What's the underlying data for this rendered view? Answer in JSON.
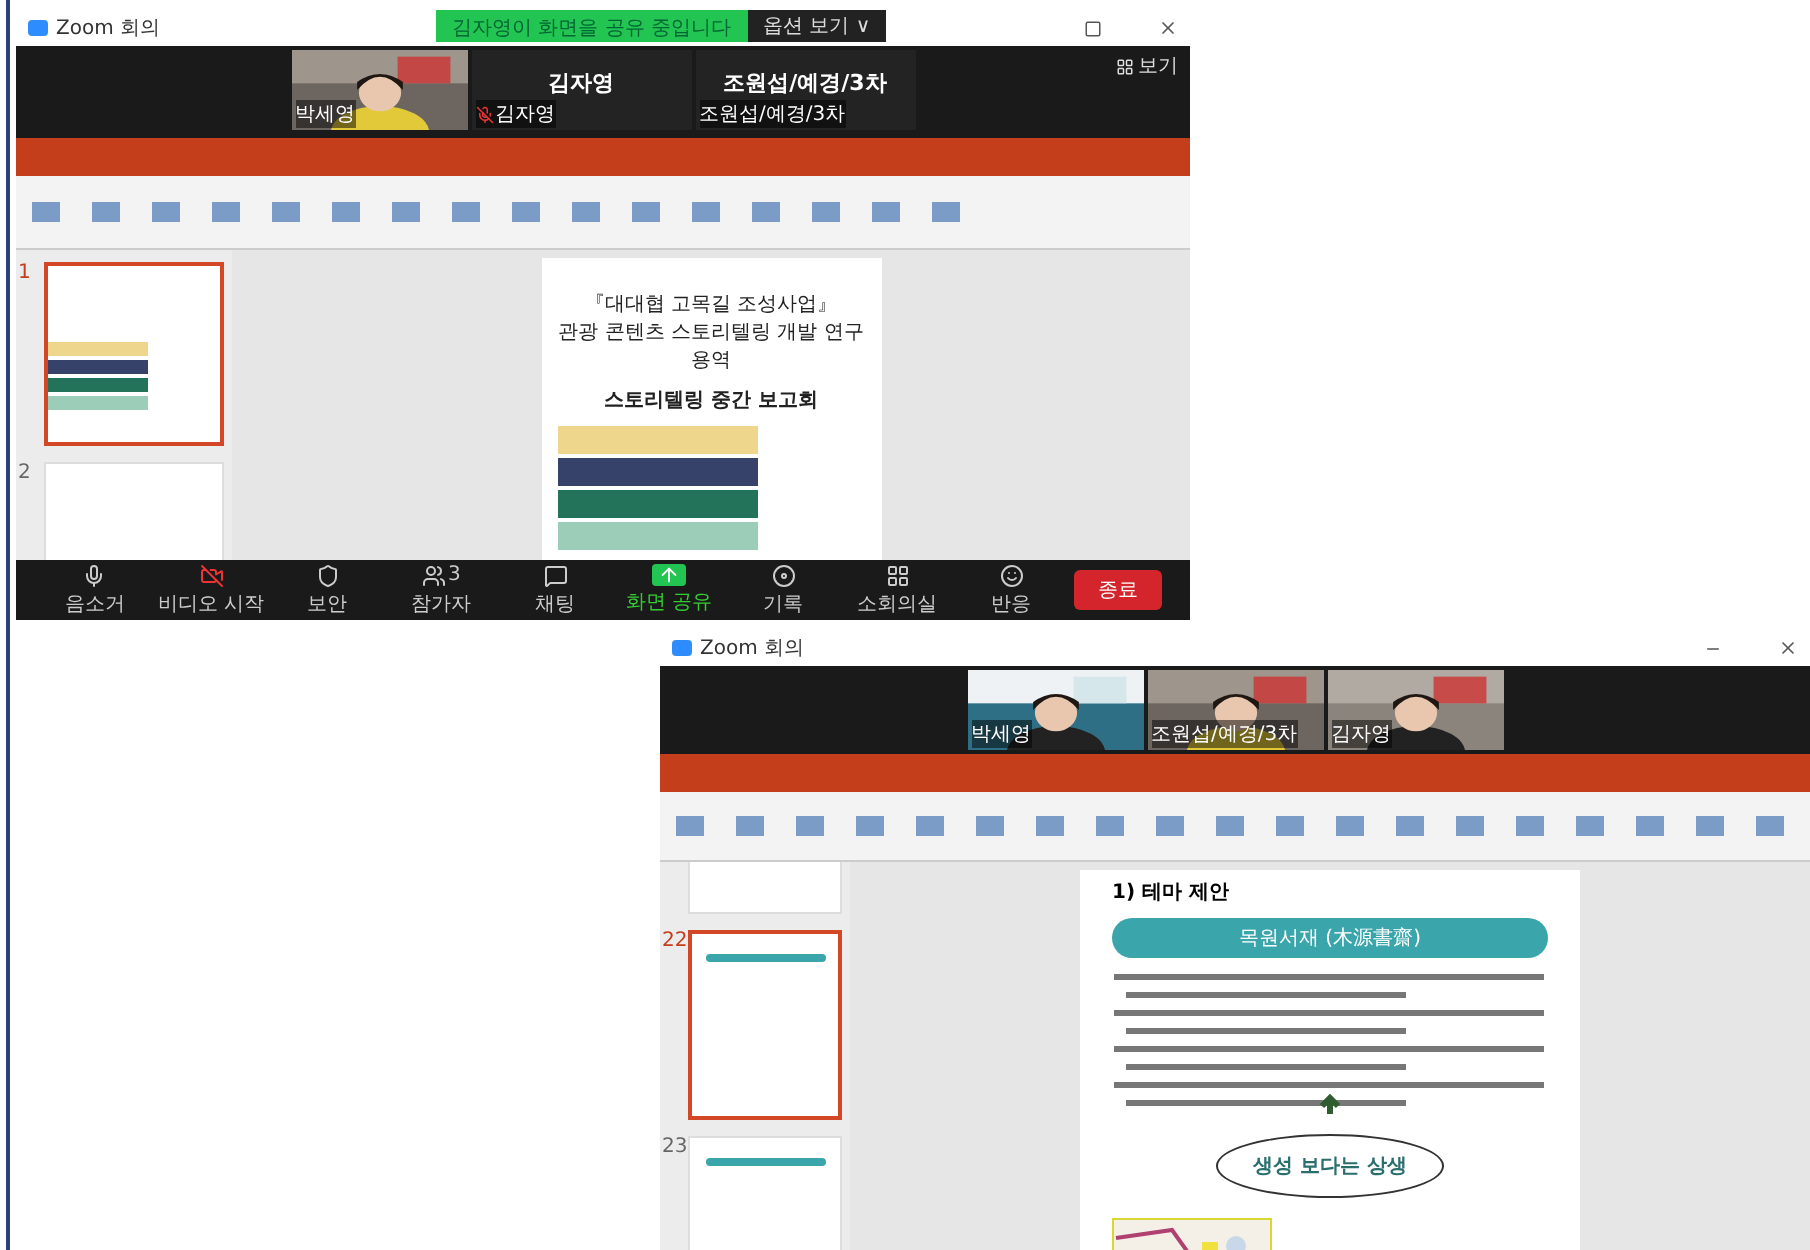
{
  "meeting_window": {
    "title": "Zoom 회의",
    "share_banner": "김자영이 화면을 공유 중입니다",
    "options_button": "옵션 보기 ∨",
    "view_button": "보기",
    "participants": [
      {
        "kind": "video",
        "name": "박세영"
      },
      {
        "kind": "name",
        "display": "김자영",
        "name": "김자영",
        "muted": true
      },
      {
        "kind": "name",
        "display": "조원섭/예경/3차",
        "name": "조원섭/예경/3차",
        "muted": false
      }
    ],
    "slides": [
      {
        "number": "1",
        "selected": true
      },
      {
        "number": "2",
        "selected": false
      }
    ],
    "slide": {
      "title_lines": [
        "『대대협 고목길 조성사업』",
        "관광 콘텐츠 스토리텔링 개발 연구용역"
      ],
      "subtitle": "스토리텔링 중간 보고회"
    },
    "toolbar": [
      {
        "kind": "mic",
        "label": "음소거"
      },
      {
        "kind": "video_off",
        "label": "비디오 시작"
      },
      {
        "kind": "security",
        "label": "보안"
      },
      {
        "kind": "participants",
        "label": "참가자",
        "count": "3"
      },
      {
        "kind": "chat",
        "label": "채팅"
      },
      {
        "kind": "share",
        "label": "화면 공유"
      },
      {
        "kind": "record",
        "label": "기록"
      },
      {
        "kind": "rooms",
        "label": "소회의실"
      },
      {
        "kind": "reactions",
        "label": "반응"
      }
    ],
    "end_button": "종료"
  },
  "second_window": {
    "title": "Zoom 회의",
    "participants": [
      {
        "name": "박세영"
      },
      {
        "name": "조원섭/예경/3차"
      },
      {
        "name": "김자영"
      }
    ],
    "slides": [
      {
        "number": "22",
        "selected": true
      },
      {
        "number": "23",
        "selected": false
      }
    ],
    "slide": {
      "heading": "1) 테마 제안",
      "banner": "목원서재 (木源書齋)",
      "callout": "생성 보다는 상생"
    }
  }
}
